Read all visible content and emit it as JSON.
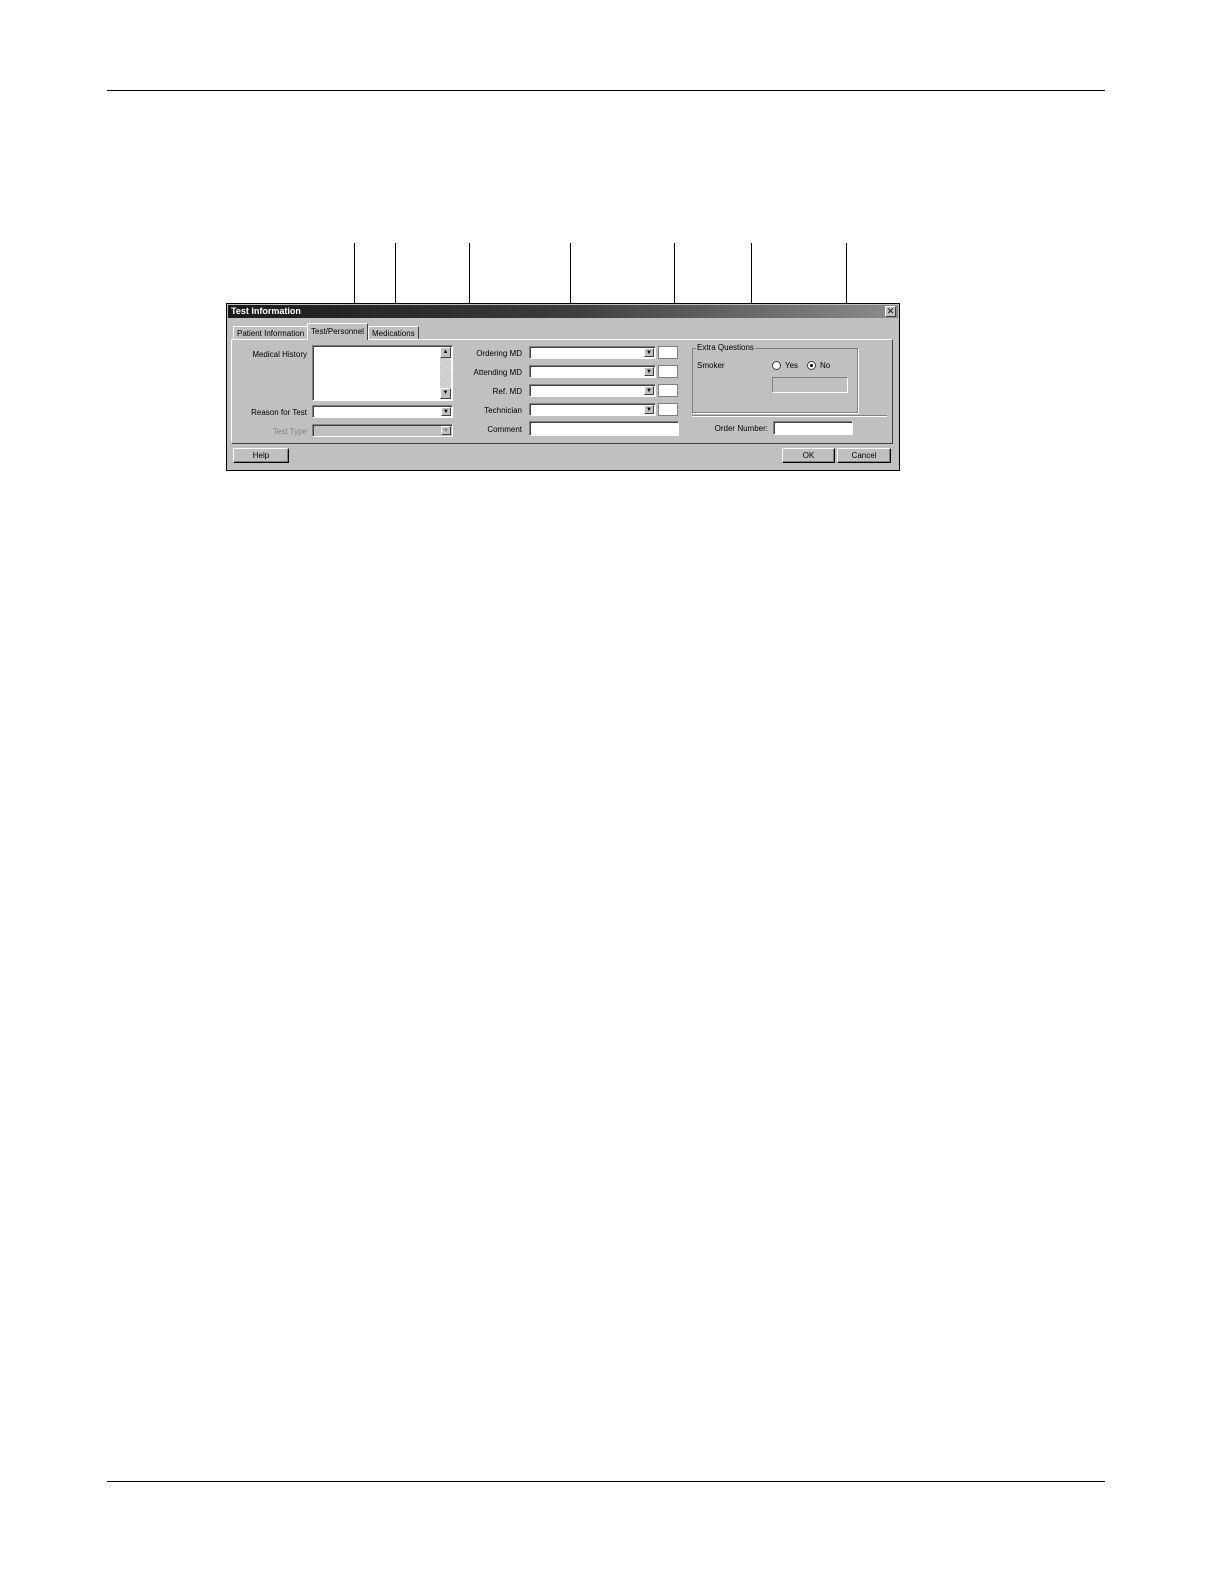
{
  "dialog": {
    "title": "Test Information",
    "close_glyph": "✕"
  },
  "tabs": [
    {
      "label": "Patient Information",
      "active": false
    },
    {
      "label": "Test/Personnel",
      "active": true
    },
    {
      "label": "Medications",
      "active": false
    }
  ],
  "left": {
    "medical_history_label": "Medical History",
    "reason_label": "Reason for Test",
    "test_type_label": "Test Type"
  },
  "middle": {
    "ordering_md_label": "Ordering MD",
    "attending_md_label": "Attending MD",
    "ref_md_label": "Ref. MD",
    "technician_label": "Technician",
    "comment_label": "Comment"
  },
  "extra": {
    "group_title": "Extra Questions",
    "smoker_label": "Smoker",
    "yes_label": "Yes",
    "no_label": "No",
    "selected": "No",
    "order_number_label": "Order Number:"
  },
  "buttons": {
    "help": "Help",
    "ok": "OK",
    "cancel": "Cancel"
  },
  "icons": {
    "dropdown": "▼",
    "scroll_up": "▲",
    "scroll_down": "▼"
  }
}
